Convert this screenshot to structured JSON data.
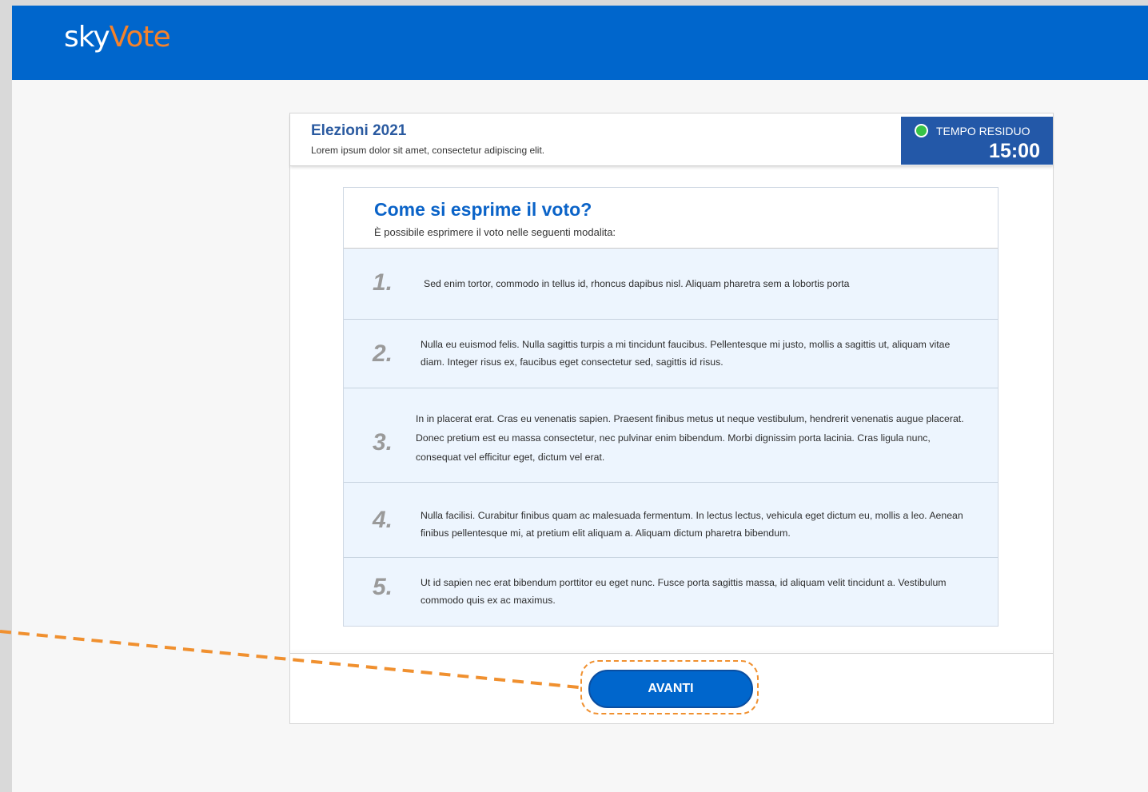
{
  "brand": {
    "name_a": "sky",
    "name_b": "Vote"
  },
  "header": {
    "title": "Elezioni 2021",
    "subtitle": "Lorem ipsum dolor sit amet, consectetur adipiscing elit."
  },
  "timer": {
    "label": "TEMPO RESIDUO",
    "value": "15:00"
  },
  "instructions": {
    "title": "Come si esprime il voto?",
    "subtitle": "È possibile esprimere il voto nelle seguenti modalita:",
    "steps": [
      {
        "number": "1.",
        "text": "Sed enim tortor, commodo in tellus id, rhoncus dapibus nisl. Aliquam pharetra sem a lobortis porta"
      },
      {
        "number": "2.",
        "text": "Nulla eu euismod felis. Nulla sagittis turpis a mi tincidunt faucibus. Pellentesque mi justo, mollis a sagittis ut, aliquam vitae diam. Integer risus ex, faucibus eget consectetur sed, sagittis id risus."
      },
      {
        "number": "3.",
        "text": "In in placerat erat. Cras eu venenatis sapien. Praesent finibus metus ut neque vestibulum, hendrerit venenatis augue placerat. Donec pretium est eu massa consectetur, nec pulvinar enim bibendum. Morbi dignissim porta lacinia. Cras ligula nunc, consequat vel efficitur eget, dictum vel erat."
      },
      {
        "number": "4.",
        "text": "Nulla facilisi. Curabitur finibus quam ac malesuada fermentum. In lectus lectus, vehicula eget dictum eu, mollis a leo. Aenean finibus pellentesque mi, at pretium elit aliquam a. Aliquam dictum pharetra bibendum."
      },
      {
        "number": "5.",
        "text": "Ut id sapien nec erat bibendum porttitor eu eget nunc. Fusce porta sagittis massa, id aliquam velit tincidunt a. Vestibulum commodo quis ex ac maximus."
      }
    ]
  },
  "actions": {
    "next_label": "AVANTI"
  },
  "colors": {
    "brand_blue": "#0066cc",
    "accent_orange": "#f5822a",
    "timer_green": "#38c447"
  }
}
